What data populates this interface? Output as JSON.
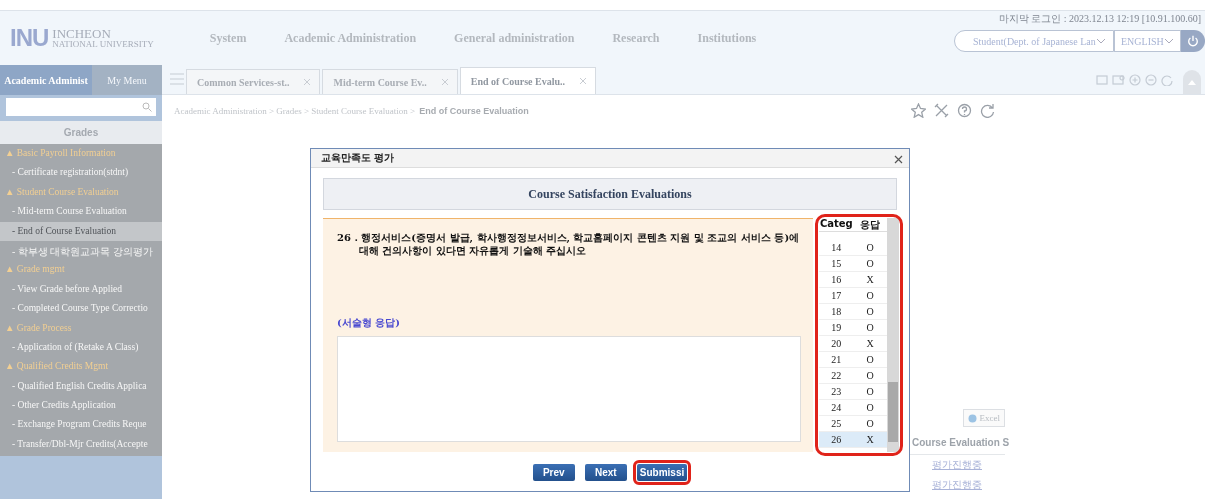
{
  "header": {
    "logo_mark": "INU",
    "logo_line1": "INCHEON",
    "logo_line2": "NATIONAL UNIVERSITY",
    "menu": [
      "System",
      "Academic Administration",
      "General administration",
      "Research",
      "Institutions"
    ],
    "last_login": "마지막 로그인 : 2023.12.13 12:19 [10.91.100.60]",
    "role_select": "Student(Dept. of Japanese Lan",
    "language_select": "ENGLISH"
  },
  "sidebar": {
    "tabs": [
      {
        "label": "Academic Administ",
        "selected": true
      },
      {
        "label": "My Menu",
        "selected": false
      }
    ],
    "title": "Grades",
    "items": [
      {
        "label": "▲ Basic Payroll Information",
        "children": [
          {
            "label": "- Certificate registration(stdnt)",
            "selected": false
          }
        ]
      },
      {
        "label": "▲ Student Course Evaluation",
        "children": [
          {
            "label": "- Mid-term Course Evaluation",
            "selected": false
          },
          {
            "label": "- End of Course Evaluation",
            "selected": true
          },
          {
            "label": "- 학부생 대학원교과목 강의평가",
            "selected": false
          }
        ]
      },
      {
        "label": "▲ Grade mgmt",
        "children": [
          {
            "label": "- View Grade before Applied",
            "selected": false
          },
          {
            "label": "- Completed Course Type Correctio",
            "selected": false
          }
        ]
      },
      {
        "label": "▲ Grade Process",
        "children": [
          {
            "label": "- Application of (Retake A Class)",
            "selected": false
          }
        ]
      },
      {
        "label": "▲ Qualified Credits Mgmt",
        "children": [
          {
            "label": "- Qualified English Credits Applica",
            "selected": false
          },
          {
            "label": "- Other Credits Application",
            "selected": false
          },
          {
            "label": "- Exchange Program Credits Reque",
            "selected": false
          },
          {
            "label": "- Transfer/Dbl-Mjr Credits(Accepte",
            "selected": false
          }
        ]
      }
    ]
  },
  "tabs": [
    {
      "label": "Common Services-st..",
      "selected": false
    },
    {
      "label": "Mid-term Course Ev..",
      "selected": false
    },
    {
      "label": "End of Course Evalu..",
      "selected": true
    }
  ],
  "breadcrumb": {
    "path": "Academic Administration > Grades > Student Course Evaluation >",
    "current": "End of Course Evaluation"
  },
  "background_table": {
    "excel_button": "Excel",
    "column_header": "Course Evaluation S",
    "rows": [
      "평가진행중",
      "평가진행중"
    ]
  },
  "modal": {
    "title": "교육만족도 평가",
    "heading": "Course Satisfaction Evaluations",
    "question": "26 . 행정서비스(증명서 발급, 학사행정정보서비스, 학교홈페이지 콘텐츠 지원 및 조교의 서비스 등)에 대해 건의사항이 있다면 자유롭게 기술해 주십시오",
    "answer_label": "(서술형 응답)",
    "answer_table": {
      "highlighted": true,
      "columns": [
        "Categ",
        "응답"
      ],
      "rows": [
        {
          "number": "14",
          "answer": "O",
          "selected": false
        },
        {
          "number": "15",
          "answer": "O",
          "selected": false
        },
        {
          "number": "16",
          "answer": "X",
          "selected": false
        },
        {
          "number": "17",
          "answer": "O",
          "selected": false
        },
        {
          "number": "18",
          "answer": "O",
          "selected": false
        },
        {
          "number": "19",
          "answer": "O",
          "selected": false
        },
        {
          "number": "20",
          "answer": "X",
          "selected": false
        },
        {
          "number": "21",
          "answer": "O",
          "selected": false
        },
        {
          "number": "22",
          "answer": "O",
          "selected": false
        },
        {
          "number": "23",
          "answer": "O",
          "selected": false
        },
        {
          "number": "24",
          "answer": "O",
          "selected": false
        },
        {
          "number": "25",
          "answer": "O",
          "selected": false
        },
        {
          "number": "26",
          "answer": "X",
          "selected": true
        }
      ]
    },
    "buttons": [
      {
        "label": "Prev",
        "highlighted": false
      },
      {
        "label": "Next",
        "highlighted": false
      },
      {
        "label": "Submissi",
        "highlighted": true
      }
    ]
  }
}
